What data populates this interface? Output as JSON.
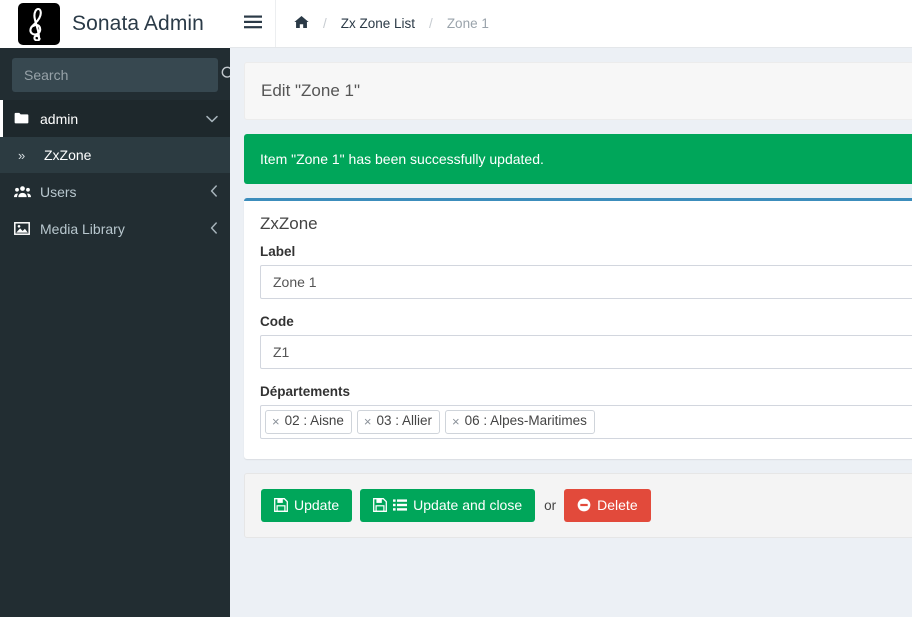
{
  "brand": {
    "name": "Sonata Admin",
    "logo_icon": "treble-clef-icon"
  },
  "navbar": {
    "toggle_icon": "hamburger-icon",
    "breadcrumb": [
      {
        "type": "home",
        "icon": "home-icon",
        "label": ""
      },
      {
        "type": "separator",
        "label": "/"
      },
      {
        "type": "link",
        "label": "Zx Zone List"
      },
      {
        "type": "separator",
        "label": "/"
      },
      {
        "type": "current",
        "label": "Zone 1"
      }
    ]
  },
  "sidebar": {
    "search": {
      "placeholder": "Search",
      "value": "",
      "icon": "search-icon"
    },
    "items": [
      {
        "label": "admin",
        "icon": "folder-icon",
        "arrow": "chevron-down-icon",
        "arrow_glyph": "⌄",
        "open": true,
        "children": [
          {
            "label": "ZxZone",
            "caret": "»",
            "active": true
          }
        ]
      },
      {
        "label": "Users",
        "icon": "users-icon",
        "arrow": "chevron-left-icon",
        "arrow_glyph": "‹",
        "open": false,
        "children": []
      },
      {
        "label": "Media Library",
        "icon": "image-icon",
        "arrow": "chevron-left-icon",
        "arrow_glyph": "‹",
        "open": false,
        "children": []
      }
    ]
  },
  "main": {
    "page_title": "Edit \"Zone 1\"",
    "alert": {
      "message": "Item \"Zone 1\" has been successfully updated.",
      "type": "success",
      "color": "#00a65a"
    },
    "form": {
      "box_title": "ZxZone",
      "box_accent_color": "#3c8dbc",
      "fields": [
        {
          "name": "label",
          "label": "Label",
          "type": "text",
          "value": "Zone 1",
          "placeholder": ""
        },
        {
          "name": "code",
          "label": "Code",
          "type": "text",
          "value": "Z1",
          "placeholder": ""
        },
        {
          "name": "departements",
          "label": "Départements",
          "type": "multiselect",
          "tags": [
            {
              "remove": "×",
              "label": "02 : Aisne"
            },
            {
              "remove": "×",
              "label": "03 : Allier"
            },
            {
              "remove": "×",
              "label": "06 : Alpes-Maritimes"
            }
          ]
        }
      ]
    },
    "actions": {
      "update_label": "Update",
      "update_icon": "save-icon",
      "update_and_close_label": "Update and close",
      "update_and_close_icons": [
        "save-icon",
        "list-icon"
      ],
      "or_label": "or",
      "delete_label": "Delete",
      "delete_icon": "minus-circle-icon",
      "success_color": "#00a65a",
      "danger_color": "#e24a3b"
    }
  }
}
